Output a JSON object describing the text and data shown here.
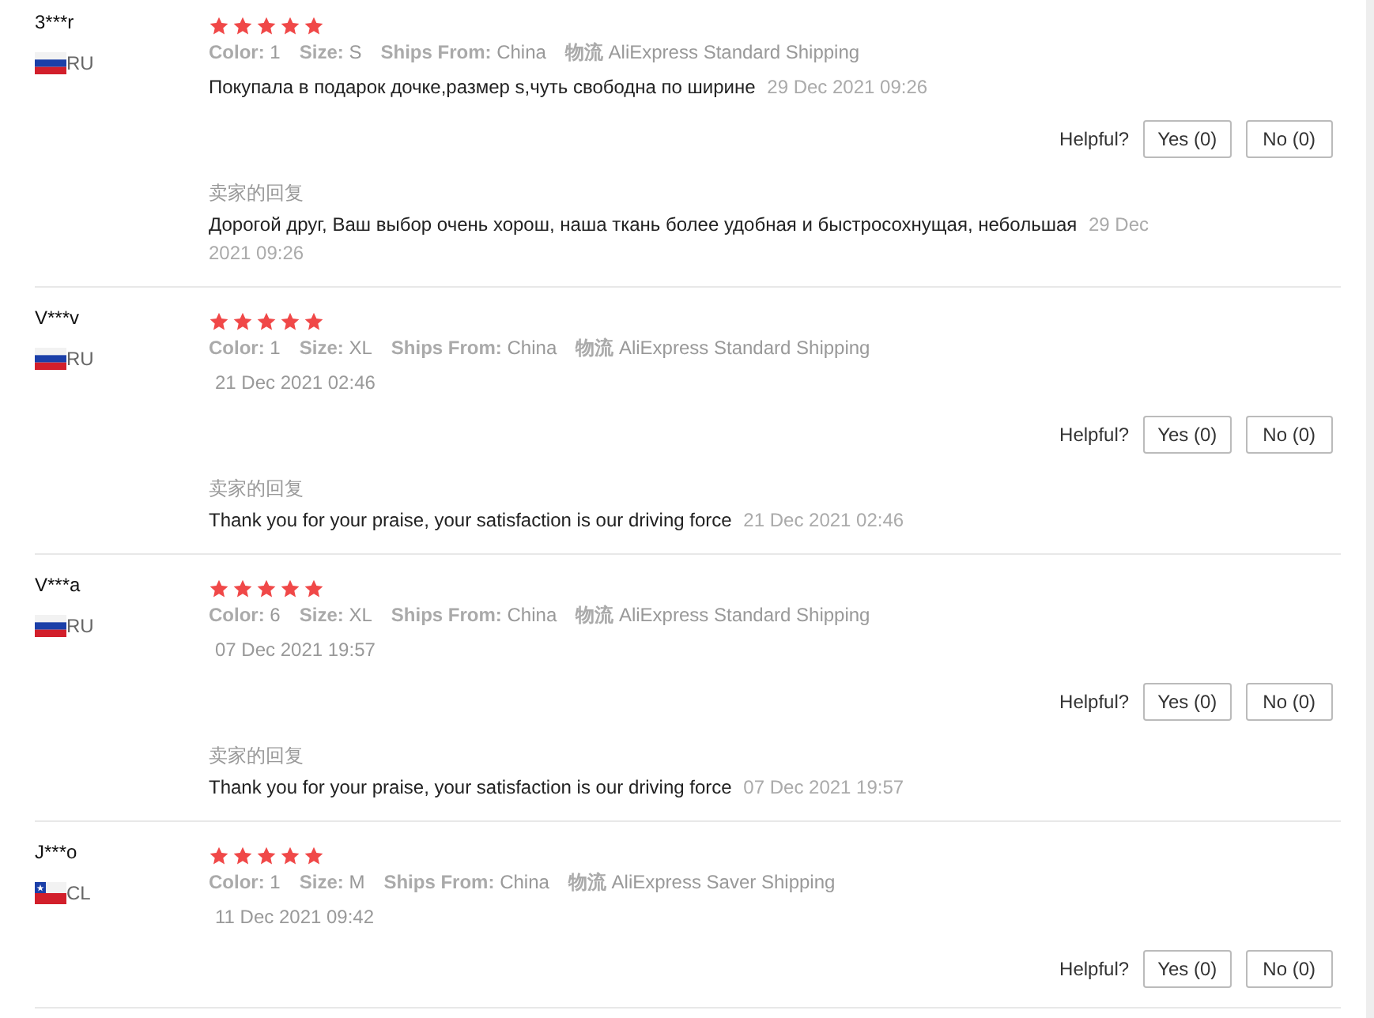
{
  "reviews": [
    {
      "user": "3***r",
      "flag": {
        "kind": "russia"
      },
      "country": "RU",
      "stars": 5,
      "attributes": [
        {
          "label": "Color:",
          "value": "1"
        },
        {
          "label": "Size:",
          "value": "S"
        },
        {
          "label": "Ships From:",
          "value": "China"
        },
        {
          "label": "物流",
          "value": "AliExpress Standard Shipping"
        }
      ],
      "text": "Покупала в подарок дочке,размер s,чуть свободна по ширине",
      "date": "29 Dec 2021 09:26",
      "helpful_label": "Helpful?",
      "yes": "Yes (0)",
      "no": "No (0)",
      "reply": {
        "title": "卖家的回复",
        "text": "Дорогой друг, Ваш выбор очень хорош, наша ткань более удобная и быстросохнущая, небольшая",
        "date": "29 Dec 2021 09:26"
      }
    },
    {
      "user": "V***v",
      "flag": {
        "kind": "russia"
      },
      "country": "RU",
      "stars": 5,
      "attributes": [
        {
          "label": "Color:",
          "value": "1"
        },
        {
          "label": "Size:",
          "value": "XL"
        },
        {
          "label": "Ships From:",
          "value": "China"
        },
        {
          "label": "物流",
          "value": "AliExpress Standard Shipping"
        }
      ],
      "date": "21 Dec 2021 02:46",
      "helpful_label": "Helpful?",
      "yes": "Yes (0)",
      "no": "No (0)",
      "reply": {
        "title": "卖家的回复",
        "text": "Thank you for your praise, your satisfaction is our driving force",
        "date": "21 Dec 2021 02:46"
      }
    },
    {
      "user": "V***a",
      "flag": {
        "kind": "russia"
      },
      "country": "RU",
      "stars": 5,
      "attributes": [
        {
          "label": "Color:",
          "value": "6"
        },
        {
          "label": "Size:",
          "value": "XL"
        },
        {
          "label": "Ships From:",
          "value": "China"
        },
        {
          "label": "物流",
          "value": "AliExpress Standard Shipping"
        }
      ],
      "date": "07 Dec 2021 19:57",
      "helpful_label": "Helpful?",
      "yes": "Yes (0)",
      "no": "No (0)",
      "reply": {
        "title": "卖家的回复",
        "text": "Thank you for your praise, your satisfaction is our driving force",
        "date": "07 Dec 2021 19:57"
      }
    },
    {
      "user": "J***o",
      "flag": {
        "kind": "chile"
      },
      "country": "CL",
      "stars": 5,
      "attributes": [
        {
          "label": "Color:",
          "value": "1"
        },
        {
          "label": "Size:",
          "value": "M"
        },
        {
          "label": "Ships From:",
          "value": "China"
        },
        {
          "label": "物流",
          "value": "AliExpress Saver Shipping"
        }
      ],
      "date": "11 Dec 2021 09:42",
      "helpful_label": "Helpful?",
      "yes": "Yes (0)",
      "no": "No (0)"
    }
  ]
}
